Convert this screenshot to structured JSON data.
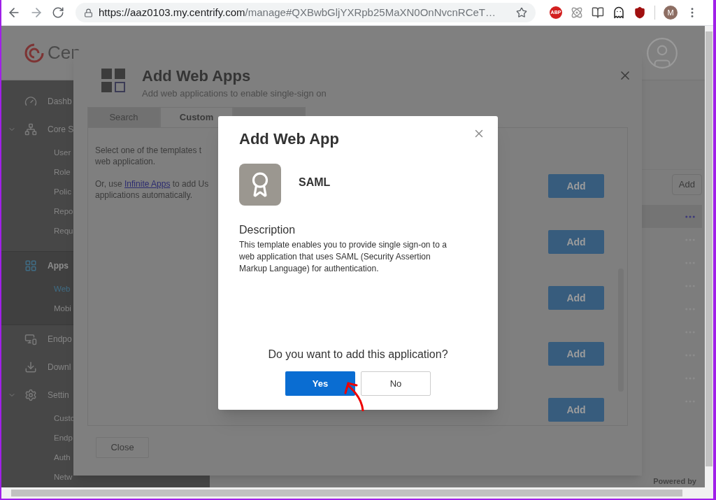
{
  "browser": {
    "url_host": "https://aaz0103.my.centrify.com",
    "url_path": "/manage#QXBwbGljYXRpb25MaXN0OnNvcnRCeT…",
    "abp_label": "ABP",
    "profile_initial": "M"
  },
  "header": {
    "logo_text": "Cen"
  },
  "sidebar": {
    "sections": [
      {
        "label": "Dashb",
        "active": false
      },
      {
        "label": "Core S",
        "active": false,
        "children": [
          {
            "label": "User",
            "selected": false
          },
          {
            "label": "Role",
            "selected": false
          },
          {
            "label": "Polic",
            "selected": false
          },
          {
            "label": "Repo",
            "selected": false
          },
          {
            "label": "Requ",
            "selected": false
          }
        ]
      },
      {
        "label": "Apps",
        "active": true,
        "children": [
          {
            "label": "Web",
            "selected": true
          },
          {
            "label": "Mobi",
            "selected": false
          }
        ]
      },
      {
        "label": "Endpo",
        "active": false
      },
      {
        "label": "Downl",
        "active": false
      },
      {
        "label": "Settin",
        "active": false,
        "children": [
          {
            "label": "Custo",
            "selected": false
          },
          {
            "label": "Endp",
            "selected": false
          },
          {
            "label": "Auth",
            "selected": false
          },
          {
            "label": "Netw",
            "selected": false
          }
        ]
      }
    ]
  },
  "background": {
    "add_button": "Add",
    "rows": [
      {
        "selected": true
      },
      {
        "selected": false
      },
      {
        "selected": false
      },
      {
        "selected": false
      },
      {
        "selected": false
      },
      {
        "selected": false
      },
      {
        "selected": false
      },
      {
        "selected": false
      },
      {
        "selected": false
      }
    ],
    "powered_by": "Powered by"
  },
  "modal": {
    "title": "Add Web Apps",
    "subtitle": "Add web applications to enable single-sign on",
    "tabs": [
      {
        "label": "Search",
        "selected": false
      },
      {
        "label": "Custom",
        "selected": true
      },
      {
        "selected": false
      }
    ],
    "intro_lines": [
      "Select one of the templates t",
      "web application."
    ],
    "link_para": {
      "before": "Or, use",
      "link": "Infinite Apps",
      "after": "to add Us",
      "line2": "applications automatically."
    },
    "add_buttons": [
      "Add",
      "Add",
      "Add",
      "Add",
      "Add"
    ],
    "close_button": "Close"
  },
  "dialog": {
    "title": "Add Web App",
    "app_name": "SAML",
    "description_heading": "Description",
    "description": "This template enables you to provide single sign-on to a web application that uses SAML (Security Assertion Markup Language) for authentication.",
    "question": "Do you want to add this application?",
    "confirm": "Yes",
    "cancel": "No"
  }
}
